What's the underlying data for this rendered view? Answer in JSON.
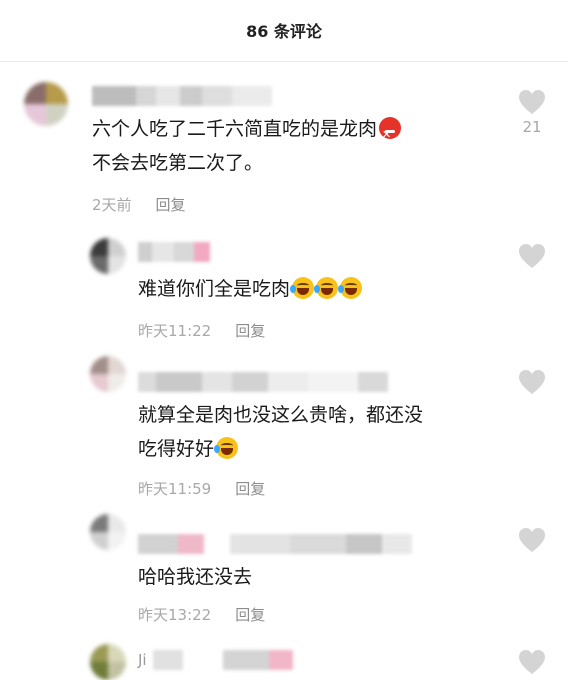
{
  "header": {
    "title": "86 条评论"
  },
  "comments": [
    {
      "text_line1": "六个人吃了二千六简直吃的是龙肉",
      "emoji1": "angry-face-emoji",
      "text_line2": "不会去吃第二次了。",
      "time": "2天前",
      "reply": "回复",
      "likes": "21"
    },
    {
      "text_line1": "难道你们全是吃肉",
      "emoji1": "tears-of-joy-emoji",
      "time": "昨天11:22",
      "reply": "回复"
    },
    {
      "text_line1": "就算全是肉也没这么贵啥，都还没",
      "text_line2": "吃得好好",
      "emoji1": "tears-of-joy-emoji",
      "time": "昨天11:59",
      "reply": "回复"
    },
    {
      "text_line1": "哈哈我还没去",
      "time": "昨天13:22",
      "reply": "回复"
    },
    {
      "name_prefix": "Ji"
    }
  ],
  "colors": {
    "meta_text": "#a8a8a8",
    "heart": "#d4d4d4",
    "angry_emoji": "#e5332a",
    "laugh_emoji": "#f7c21a"
  }
}
